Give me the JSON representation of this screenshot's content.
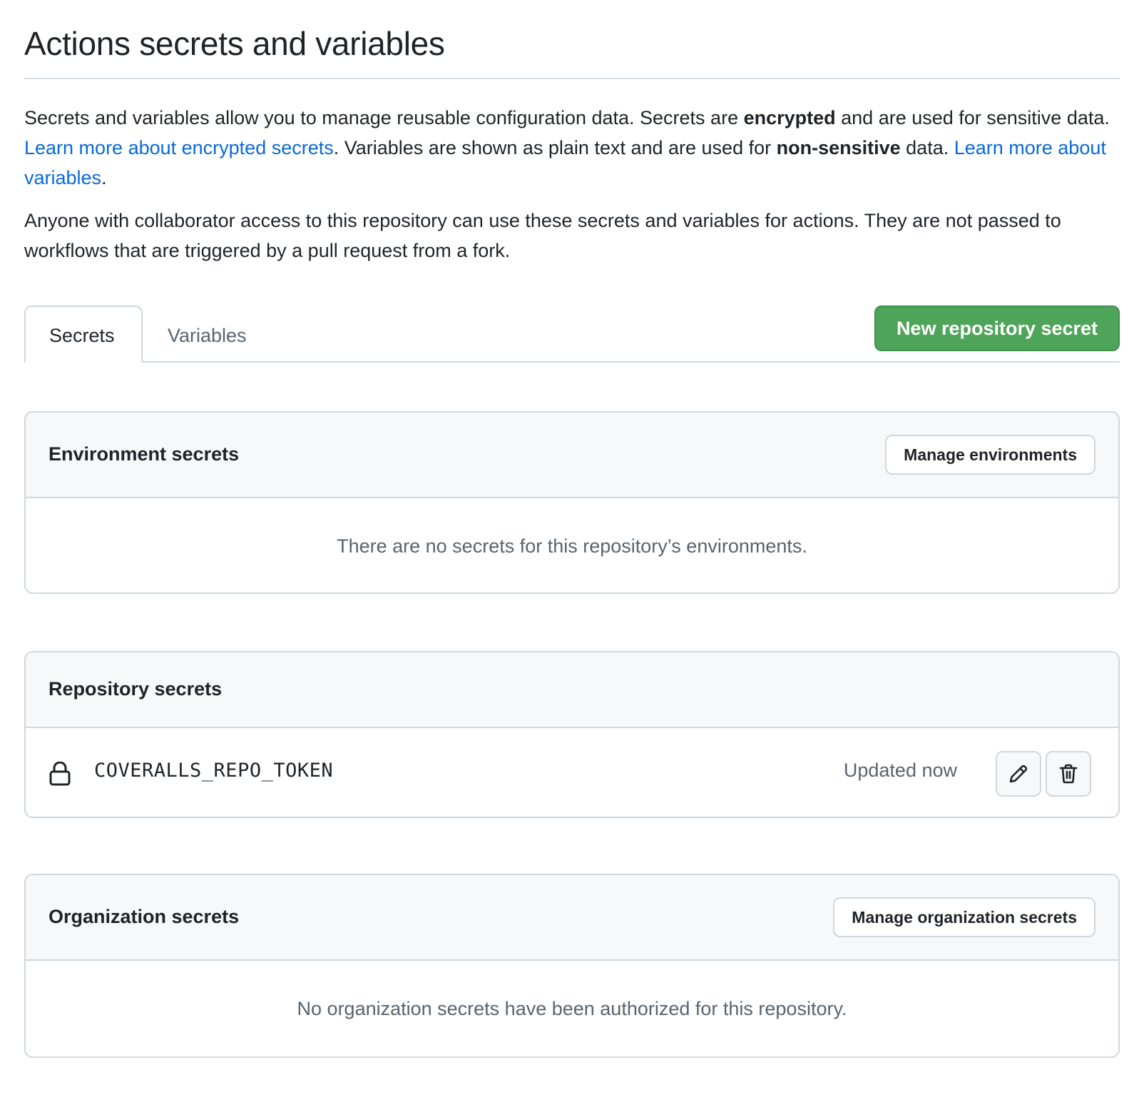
{
  "page": {
    "title": "Actions secrets and variables"
  },
  "intro": {
    "p1_part1": "Secrets and variables allow you to manage reusable configuration data. Secrets are ",
    "p1_bold1": "encrypted",
    "p1_part2": " and are used for sensitive data. ",
    "p1_link1": "Learn more about encrypted secrets",
    "p1_part3": ". Variables are shown as plain text and are used for ",
    "p1_bold2": "non-sensitive",
    "p1_part4": " data. ",
    "p1_link2": "Learn more about variables",
    "p1_part5": ".",
    "p2": "Anyone with collaborator access to this repository can use these secrets and variables for actions. They are not passed to workflows that are triggered by a pull request from a fork."
  },
  "tabs": [
    {
      "label": "Secrets",
      "selected": true
    },
    {
      "label": "Variables",
      "selected": false
    }
  ],
  "new_secret_button": "New repository secret",
  "environment_secrets": {
    "title": "Environment secrets",
    "button": "Manage environments",
    "empty_text": "There are no secrets for this repository’s environments."
  },
  "repository_secrets": {
    "title": "Repository secrets",
    "items": [
      {
        "name": "COVERALLS_REPO_TOKEN",
        "updated": "Updated now",
        "icon": "lock-icon"
      }
    ]
  },
  "organization_secrets": {
    "title": "Organization secrets",
    "button": "Manage organization secrets",
    "empty_text": "No organization secrets have been authorized for this repository."
  },
  "colors": {
    "primary_button": "#4ea55a",
    "link": "#0969da",
    "border": "#d0d7de",
    "header_bg": "#f6f8fa"
  }
}
